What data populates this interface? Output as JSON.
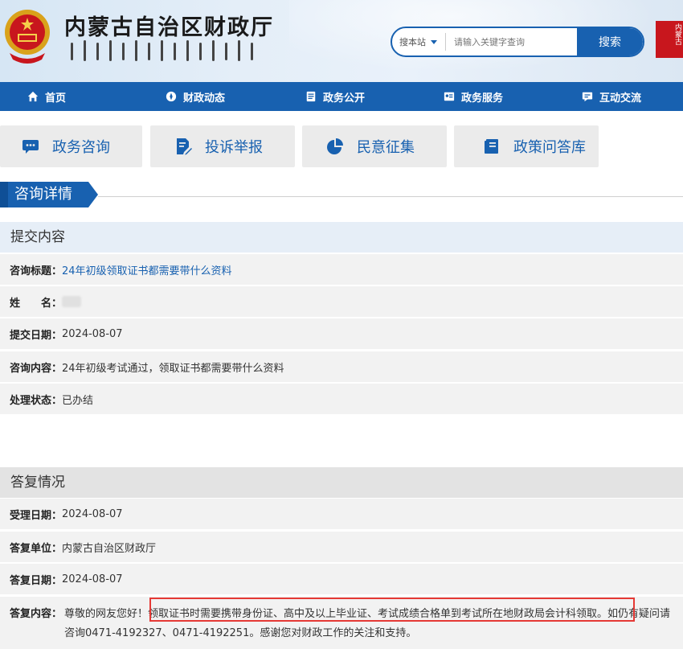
{
  "header": {
    "site_title": "内蒙古自治区财政厅",
    "search": {
      "scope_label": "搜本站",
      "placeholder": "请输入关键字查询",
      "button_label": "搜索"
    },
    "seal_text": "内蒙古"
  },
  "nav": [
    {
      "label": "首页",
      "icon": "home-icon"
    },
    {
      "label": "财政动态",
      "icon": "compass-icon"
    },
    {
      "label": "政务公开",
      "icon": "document-icon"
    },
    {
      "label": "政务服务",
      "icon": "id-card-icon"
    },
    {
      "label": "互动交流",
      "icon": "chat-board-icon"
    }
  ],
  "quick_tabs": [
    {
      "label": "政务咨询",
      "icon": "chat-bubble-icon"
    },
    {
      "label": "投诉举报",
      "icon": "edit-document-icon"
    },
    {
      "label": "民意征集",
      "icon": "pie-chart-icon"
    },
    {
      "label": "政策问答库",
      "icon": "book-icon"
    }
  ],
  "section_title": "咨询详情",
  "submission": {
    "heading": "提交内容",
    "rows": [
      {
        "label": "咨询标题：",
        "value": "24年初级领取证书都需要带什么资料"
      },
      {
        "label": "姓　　名：",
        "value": ""
      },
      {
        "label": "提交日期：",
        "value": "2024-08-07"
      },
      {
        "label": "咨询内容：",
        "value": "24年初级考试通过，领取证书都需要带什么资料"
      },
      {
        "label": "处理状态：",
        "value": "已办结"
      }
    ]
  },
  "reply": {
    "heading": "答复情况",
    "rows": [
      {
        "label": "受理日期：",
        "value": "2024-08-07"
      },
      {
        "label": "答复单位：",
        "value": "内蒙古自治区财政厅"
      },
      {
        "label": "答复日期：",
        "value": "2024-08-07"
      }
    ],
    "content_label": "答复内容：",
    "content_greeting": "尊敬的网友您好！",
    "content_highlight": "领取证书时需要携带身份证、高中及以上毕业证、考试成绩合格单到考试所在地财政局会计科领取。",
    "content_rest": "如仍有疑问请咨询0471-4192327、0471-4192251。感谢您对财政工作的关注和支持。"
  },
  "colors": {
    "primary": "#1861b0",
    "highlight_border": "#e53935",
    "row_bg": "#f2f2f2"
  }
}
